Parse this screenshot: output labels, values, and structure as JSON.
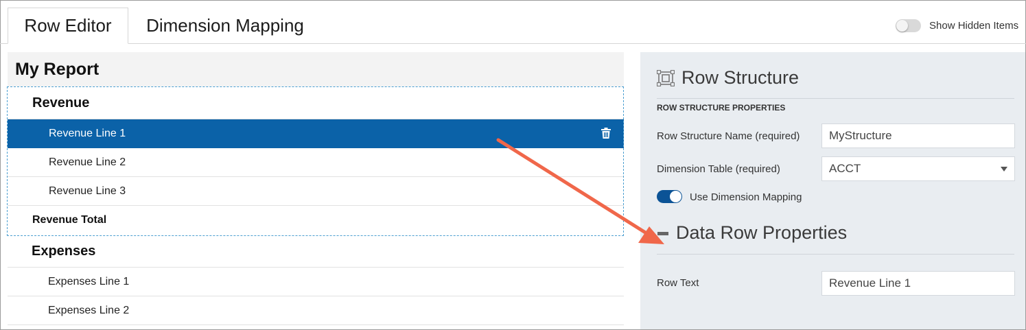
{
  "tabs": [
    {
      "label": "Row Editor",
      "active": true
    },
    {
      "label": "Dimension Mapping",
      "active": false
    }
  ],
  "show_hidden": {
    "label": "Show Hidden Items",
    "on": false
  },
  "report": {
    "title": "My Report",
    "rows": [
      {
        "type": "header",
        "label": "Revenue"
      },
      {
        "type": "line",
        "label": "Revenue Line 1",
        "selected": true
      },
      {
        "type": "line",
        "label": "Revenue Line 2"
      },
      {
        "type": "line",
        "label": "Revenue Line 3"
      },
      {
        "type": "total",
        "label": "Revenue Total"
      },
      {
        "type": "header",
        "label": "Expenses"
      },
      {
        "type": "line",
        "label": "Expenses Line 1"
      },
      {
        "type": "line",
        "label": "Expenses Line 2"
      }
    ]
  },
  "row_structure": {
    "title": "Row Structure",
    "caption": "ROW STRUCTURE PROPERTIES",
    "name_label": "Row Structure Name (required)",
    "name_value": "MyStructure",
    "dim_label": "Dimension Table (required)",
    "dim_value": "ACCT",
    "mapping_label": "Use Dimension Mapping",
    "mapping_on": true
  },
  "data_row": {
    "title": "Data Row Properties",
    "row_text_label": "Row Text",
    "row_text_value": "Revenue Line 1"
  },
  "colors": {
    "selected_row": "#0b62a8",
    "arrow": "#f0674a",
    "right_panel": "#e9edf1"
  }
}
